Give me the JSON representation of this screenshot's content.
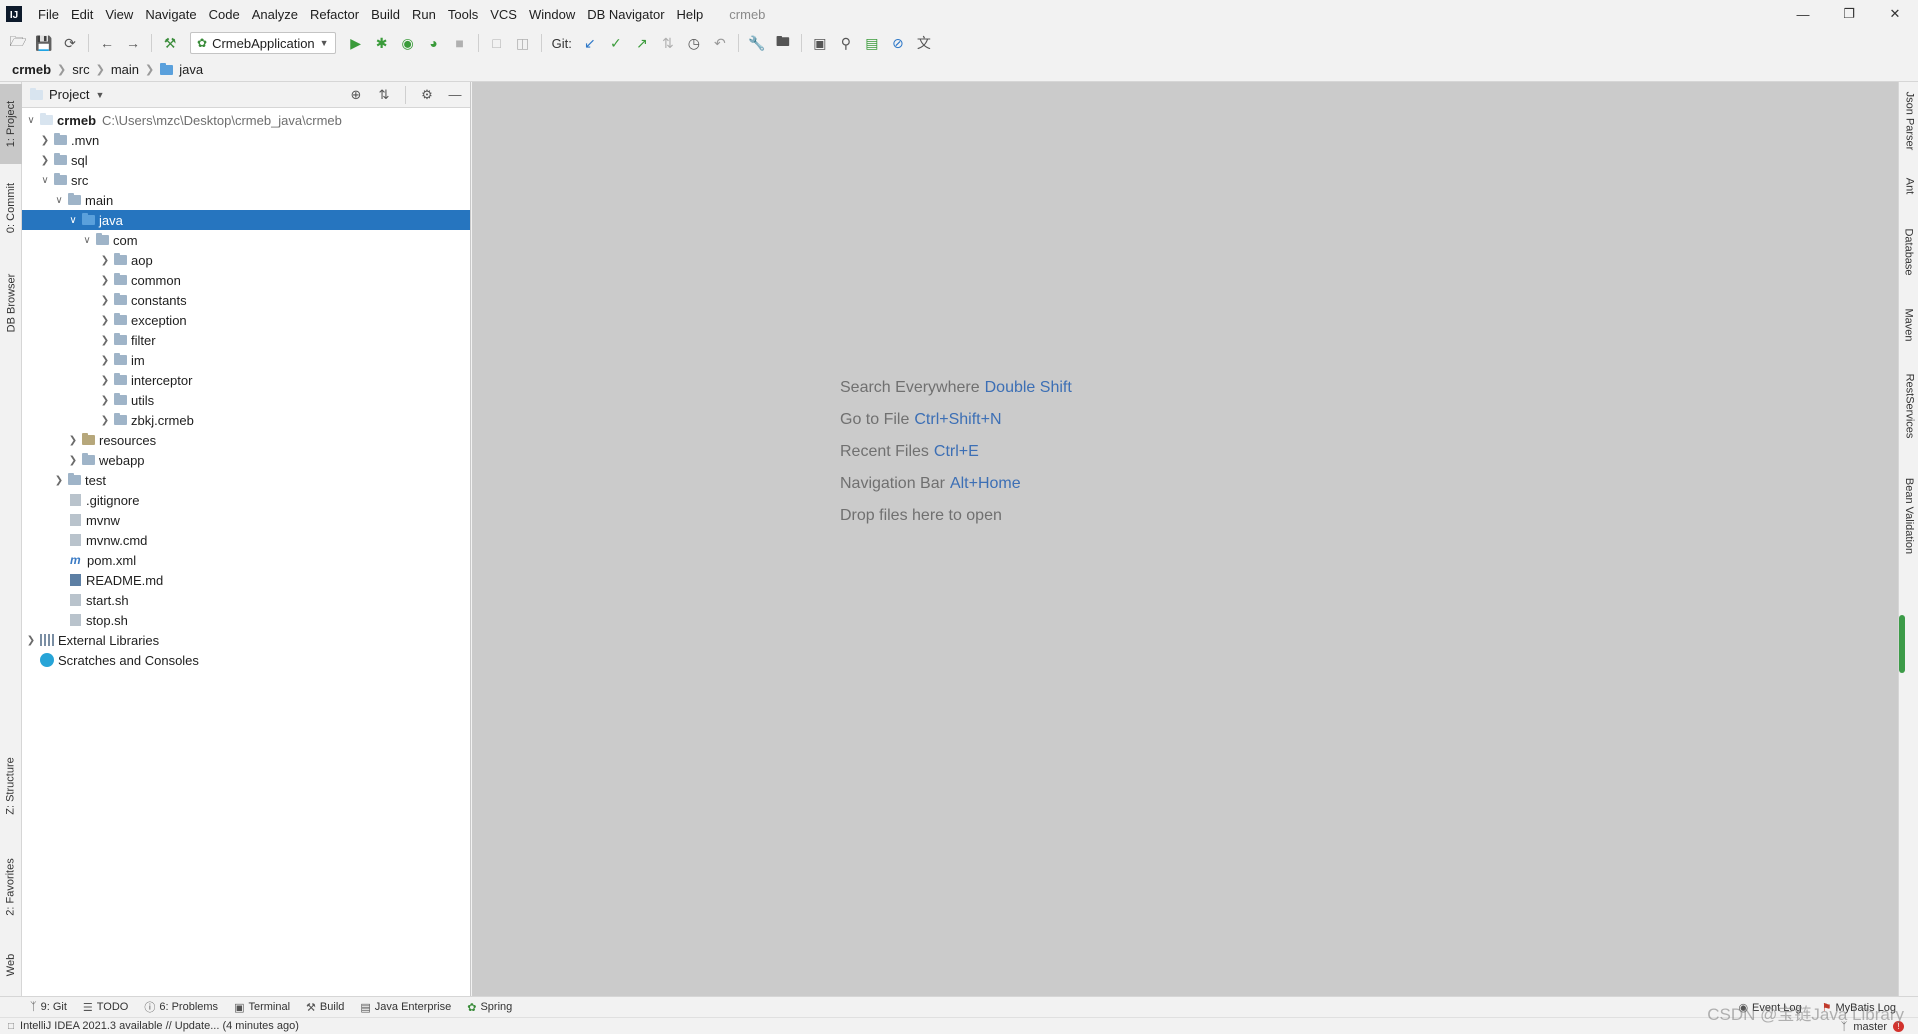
{
  "menubar": {
    "items": [
      "File",
      "Edit",
      "View",
      "Navigate",
      "Code",
      "Analyze",
      "Refactor",
      "Build",
      "Run",
      "Tools",
      "VCS",
      "Window",
      "DB Navigator",
      "Help"
    ],
    "project_title": "crmeb"
  },
  "toolbar": {
    "run_config": "CrmebApplication",
    "git_label": "Git:"
  },
  "breadcrumb": [
    "crmeb",
    "src",
    "main",
    "java"
  ],
  "left_stripe": [
    "1: Project",
    "0: Commit",
    "DB Browser",
    "Z: Structure",
    "2: Favorites",
    "Web"
  ],
  "right_stripe": [
    "Json Parser",
    "Ant",
    "Database",
    "Maven",
    "RestServices",
    "Bean Validation"
  ],
  "project_panel": {
    "title": "Project",
    "tree": [
      {
        "label": "crmeb",
        "hint": "C:\\Users\\mzc\\Desktop\\crmeb_java\\crmeb"
      },
      {
        "label": ".mvn"
      },
      {
        "label": "sql"
      },
      {
        "label": "src"
      },
      {
        "label": "main"
      },
      {
        "label": "java"
      },
      {
        "label": "com"
      },
      {
        "label": "aop"
      },
      {
        "label": "common"
      },
      {
        "label": "constants"
      },
      {
        "label": "exception"
      },
      {
        "label": "filter"
      },
      {
        "label": "im"
      },
      {
        "label": "interceptor"
      },
      {
        "label": "utils"
      },
      {
        "label": "zbkj.crmeb"
      },
      {
        "label": "resources"
      },
      {
        "label": "webapp"
      },
      {
        "label": "test"
      },
      {
        "label": ".gitignore"
      },
      {
        "label": "mvnw"
      },
      {
        "label": "mvnw.cmd"
      },
      {
        "label": "pom.xml"
      },
      {
        "label": "README.md"
      },
      {
        "label": "start.sh"
      },
      {
        "label": "stop.sh"
      },
      {
        "label": "External Libraries"
      },
      {
        "label": "Scratches and Consoles"
      }
    ]
  },
  "editor": {
    "hints": [
      {
        "text": "Search Everywhere",
        "key": "Double Shift"
      },
      {
        "text": "Go to File",
        "key": "Ctrl+Shift+N"
      },
      {
        "text": "Recent Files",
        "key": "Ctrl+E"
      },
      {
        "text": "Navigation Bar",
        "key": "Alt+Home"
      },
      {
        "text": "Drop files here to open",
        "key": ""
      }
    ]
  },
  "bottom_tabs": [
    "9: Git",
    "TODO",
    "6: Problems",
    "Terminal",
    "Build",
    "Java Enterprise",
    "Spring"
  ],
  "bottom_right": [
    "Event Log",
    "MyBatis Log"
  ],
  "status": {
    "message": "IntelliJ IDEA 2021.3 available // Update... (4 minutes ago)",
    "branch": "master"
  },
  "watermark": "CSDN @宝链Java Library",
  "colors": {
    "selection": "#2675bf",
    "editor_bg": "#cbcbcb",
    "shortcut_key": "#3c6fb5"
  }
}
